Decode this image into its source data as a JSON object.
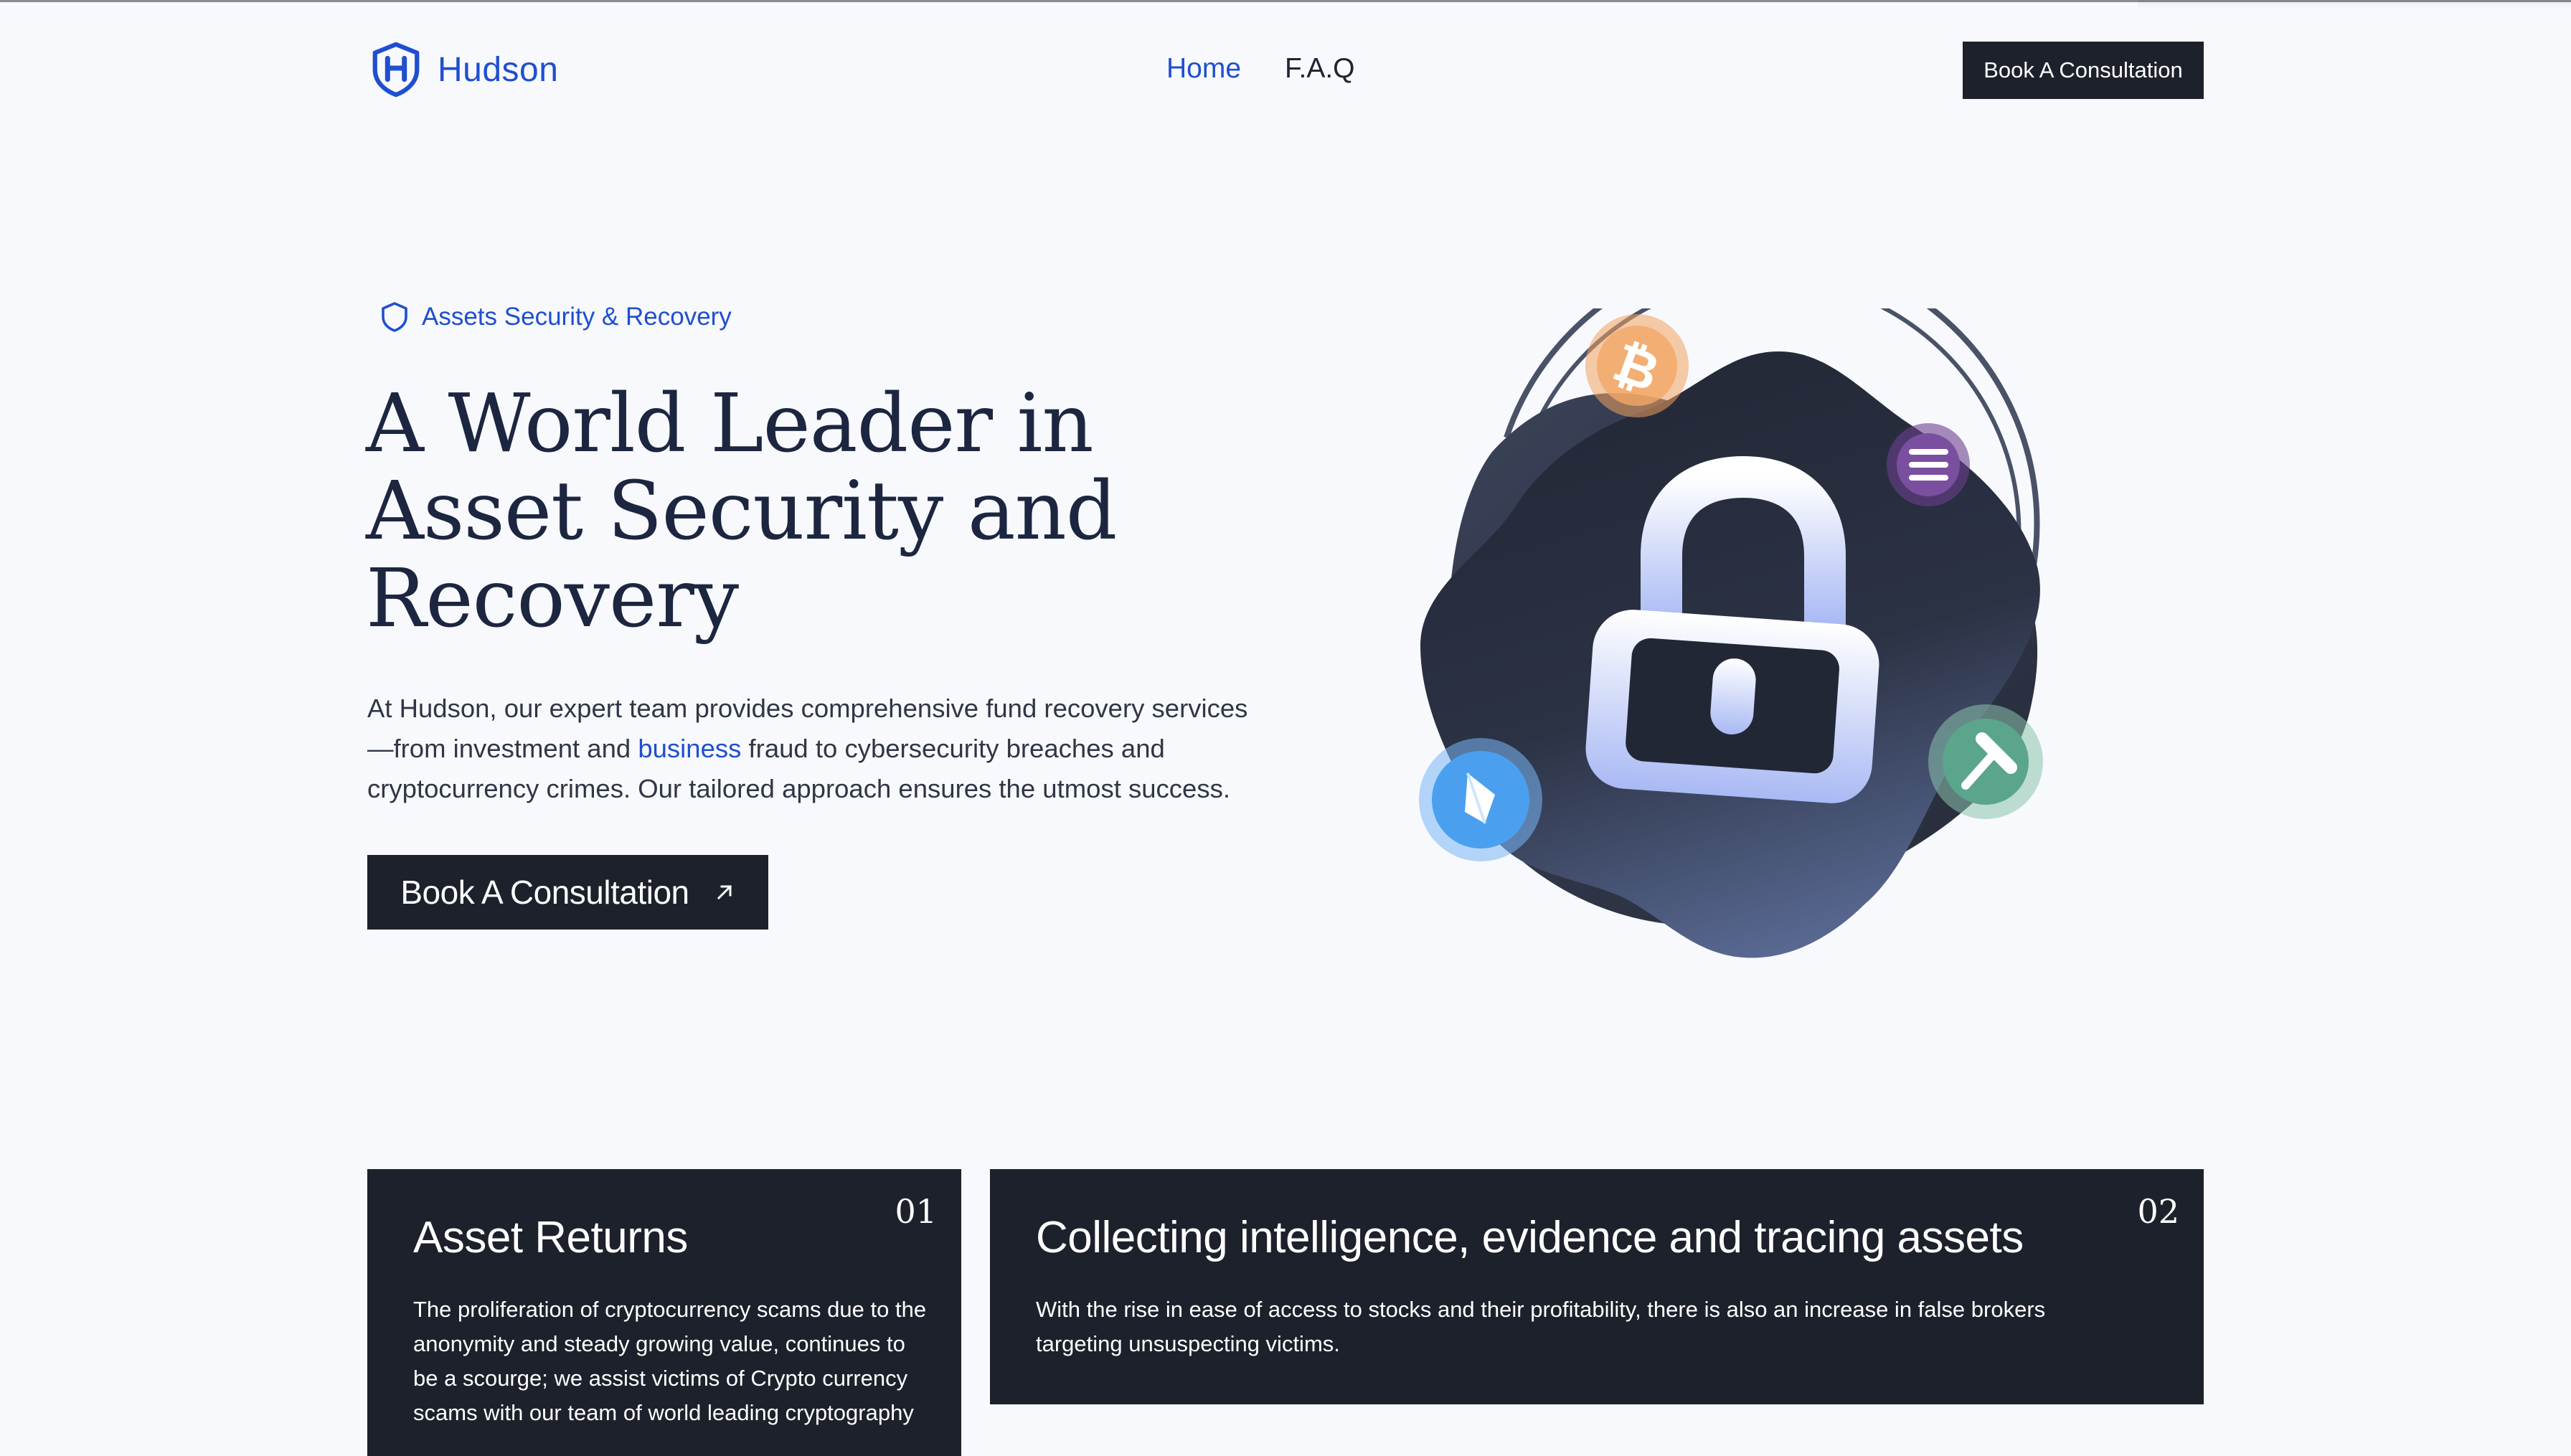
{
  "brand": {
    "name": "Hudson",
    "color": "#1f4fd0"
  },
  "nav": {
    "items": [
      {
        "label": "Home",
        "active": true
      },
      {
        "label": "F.A.Q",
        "active": false
      }
    ],
    "cta_label": "Book A Consultation"
  },
  "hero": {
    "badge": "Assets Security & Recovery",
    "title": "A World Leader in Asset Security and Recovery",
    "text_part1": "At Hudson, our expert team provides comprehensive fund recovery services —from investment and ",
    "text_link": "business",
    "text_part2": " fraud to cybersecurity breaches and cryptocurrency crimes. Our tailored approach ensures the utmost success.",
    "cta_label": "Book A Consultation",
    "illustration_icons": [
      "lock-icon",
      "bitcoin-coin-icon",
      "solana-coin-icon",
      "ethereum-coin-icon",
      "gavel-coin-icon"
    ]
  },
  "cards": [
    {
      "number": "01",
      "title": "Asset Returns",
      "text": "The proliferation of cryptocurrency scams due to the anonymity and steady growing value, continues to be a scourge; we assist victims of Crypto currency scams with our team of world leading cryptography"
    },
    {
      "number": "02",
      "title": "Collecting intelligence, evidence and tracing assets",
      "text": "With the rise in ease of access to stocks and their profitability, there is also an increase in false brokers targeting unsuspecting victims."
    }
  ],
  "colors": {
    "background": "#f8f9fd",
    "dark": "#1d212b",
    "accent": "#1f4fd0",
    "bitcoin": "#f0a35e",
    "solana": "#7b4fa0",
    "ethereum": "#4aa0ee",
    "gavel": "#5aa58c"
  }
}
